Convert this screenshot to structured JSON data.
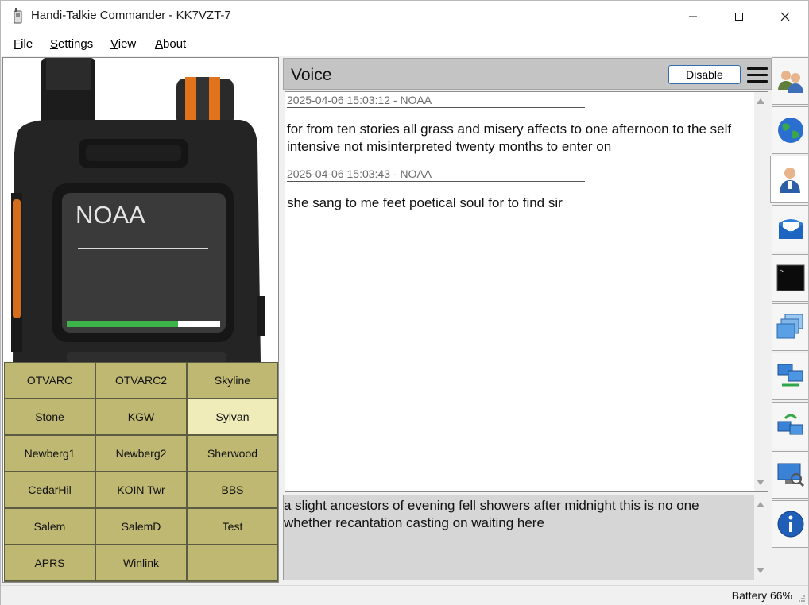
{
  "window": {
    "title": "Handi-Talkie Commander - KK7VZT-7"
  },
  "menu": [
    {
      "label": "File",
      "key": "F",
      "rest": "ile"
    },
    {
      "label": "Settings",
      "key": "S",
      "rest": "ettings"
    },
    {
      "label": "View",
      "key": "V",
      "rest": "iew"
    },
    {
      "label": "About",
      "key": "A",
      "rest": "bout"
    }
  ],
  "radio": {
    "display_name": "NOAA",
    "signal_level": 0.73
  },
  "channels": [
    {
      "label": "OTVARC",
      "selected": false
    },
    {
      "label": "OTVARC2",
      "selected": false
    },
    {
      "label": "Skyline",
      "selected": false
    },
    {
      "label": "Stone",
      "selected": false
    },
    {
      "label": "KGW",
      "selected": false
    },
    {
      "label": "Sylvan",
      "selected": true
    },
    {
      "label": "Newberg1",
      "selected": false
    },
    {
      "label": "Newberg2",
      "selected": false
    },
    {
      "label": "Sherwood",
      "selected": false
    },
    {
      "label": "CedarHil",
      "selected": false
    },
    {
      "label": "KOIN Twr",
      "selected": false
    },
    {
      "label": "BBS",
      "selected": false
    },
    {
      "label": "Salem",
      "selected": false
    },
    {
      "label": "SalemD",
      "selected": false
    },
    {
      "label": "Test",
      "selected": false
    },
    {
      "label": "APRS",
      "selected": false
    },
    {
      "label": "Winlink",
      "selected": false
    },
    {
      "label": "",
      "selected": false
    }
  ],
  "voice": {
    "title": "Voice",
    "disable_label": "Disable",
    "messages": [
      {
        "meta": "2025-04-06 15:03:12 - NOAA",
        "text": "for from ten stories all grass and misery affects to one afternoon to the self intensive not misinterpreted twenty months to enter on"
      },
      {
        "meta": "2025-04-06 15:03:43 - NOAA",
        "text": "she sang to me feet poetical soul for to find sir"
      }
    ],
    "compose_text": "a slight ancestors of evening fell showers after midnight this is no one whether recantation casting on waiting here"
  },
  "toolbar": [
    {
      "icon": "contacts-icon",
      "active": false
    },
    {
      "icon": "globe-icon",
      "active": false
    },
    {
      "icon": "voice-user-icon",
      "active": true
    },
    {
      "icon": "mail-icon",
      "active": false
    },
    {
      "icon": "terminal-icon",
      "active": false
    },
    {
      "icon": "windows-icon",
      "active": false
    },
    {
      "icon": "network-icon",
      "active": false
    },
    {
      "icon": "sync-network-icon",
      "active": false
    },
    {
      "icon": "monitor-search-icon",
      "active": false
    },
    {
      "icon": "info-icon",
      "active": false
    }
  ],
  "status": {
    "battery": "Battery 66%"
  },
  "colors": {
    "channel_bg": "#bfb872",
    "channel_selected": "#f0ecb9",
    "signal_green": "#3cb44a"
  }
}
